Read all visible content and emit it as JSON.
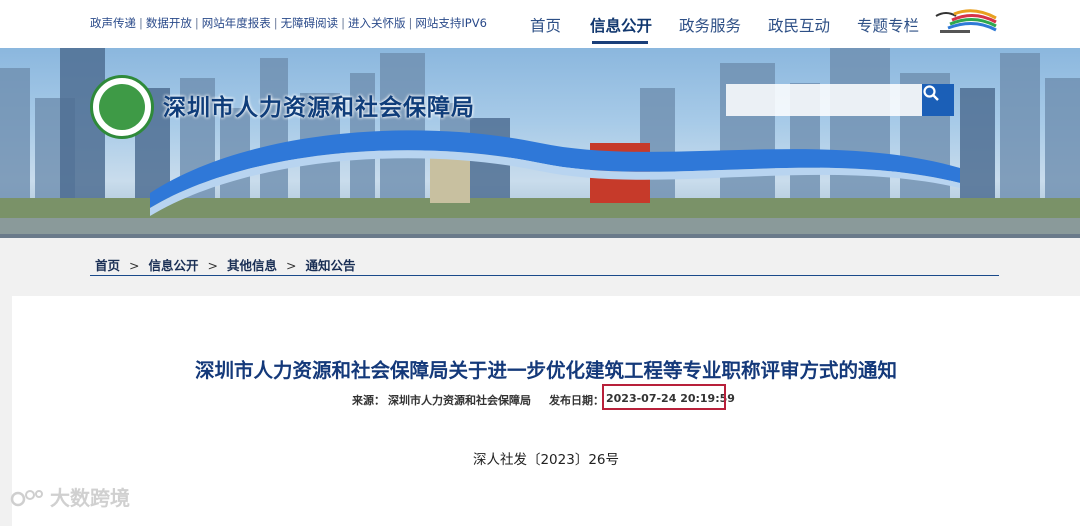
{
  "quick_links": [
    "政声传递",
    "数据开放",
    "网站年度报表",
    "无障碍阅读",
    "进入关怀版",
    "网站支持IPV6"
  ],
  "nav": {
    "items": [
      "首页",
      "信息公开",
      "政务服务",
      "政民互动",
      "专题专栏"
    ],
    "active_index": 1
  },
  "header": {
    "site_title": "深圳市人力资源和社会保障局",
    "search_placeholder": ""
  },
  "breadcrumb": [
    "首页",
    "信息公开",
    "其他信息",
    "通知公告"
  ],
  "article": {
    "title": "深圳市人力资源和社会保障局关于进一步优化建筑工程等专业职称评审方式的通知",
    "source_label": "来源：",
    "source_value": "深圳市人力资源和社会保障局",
    "date_label": "发布日期：",
    "date_value": "2023-07-24 20:19:59",
    "doc_number": "深人社发〔2023〕26号"
  },
  "watermark": "大数跨境",
  "colors": {
    "nav_text": "#2d4f86",
    "title_blue": "#14397a",
    "highlight_red": "#b8203a",
    "search_btn": "#1b5fb7"
  }
}
